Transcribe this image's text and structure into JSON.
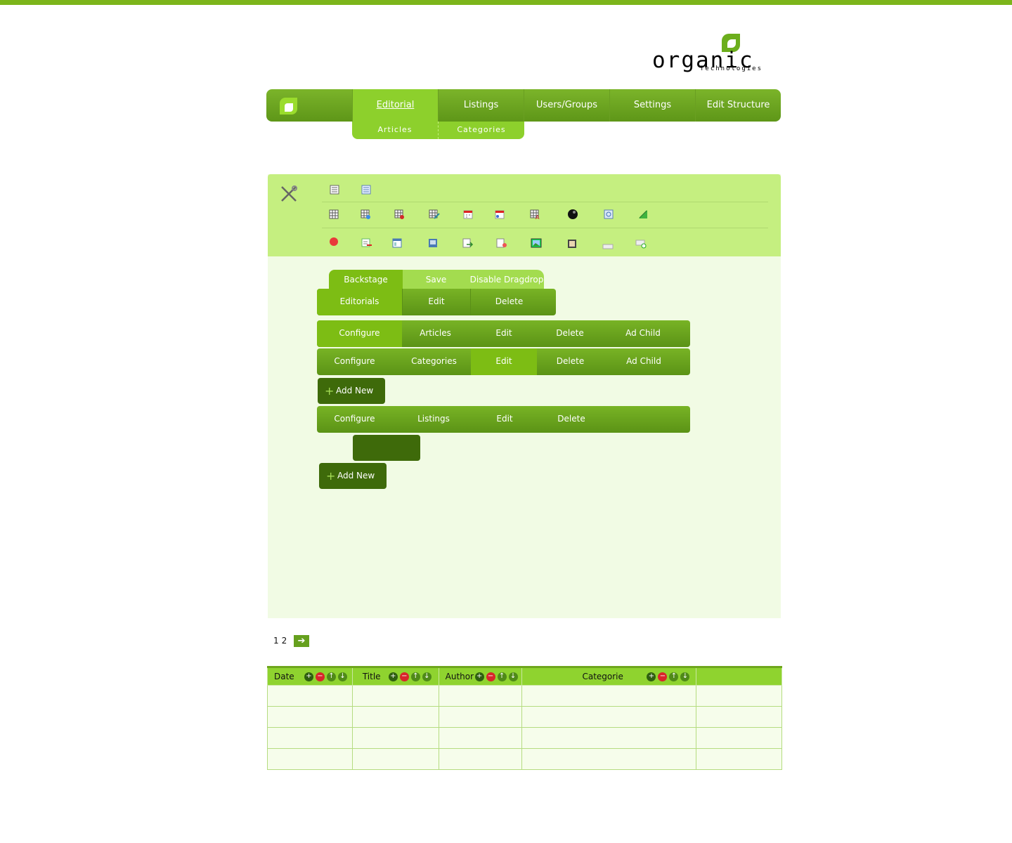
{
  "brand": {
    "logo_word": "organic",
    "logo_sub": "Technologies"
  },
  "nav": {
    "tabs": [
      "Editorial",
      "Listings",
      "Users/Groups",
      "Settings",
      "Edit Structure"
    ],
    "sub": [
      "Articles",
      "Categories"
    ]
  },
  "panel": {
    "tabs_top": [
      "Backstage",
      "Save",
      "Disable Dragdrop"
    ],
    "editorials_bar": [
      "Editorials",
      "Edit",
      "Delete"
    ],
    "articles_bar": [
      "Configure",
      "Articles",
      "Edit",
      "Delete",
      "Ad Child"
    ],
    "categories_bar": [
      "Configure",
      "Categories",
      "Edit",
      "Delete",
      "Ad Child"
    ],
    "listings_bar": [
      "Configure",
      "Listings",
      "Edit",
      "Delete"
    ],
    "add_new": "Add New"
  },
  "pager": {
    "pages": [
      "1",
      "2"
    ],
    "next": "➔"
  },
  "table": {
    "headers": [
      "Date",
      "Title",
      "Author",
      "Categorie",
      ""
    ]
  },
  "colors": {
    "accent": "#7cb51b",
    "dark": "#3e6a0a",
    "light": "#c5ef80"
  },
  "icons": [
    "tools-icon",
    "table-icon",
    "calendar-icon",
    "grid-icon",
    "image-icon",
    "edit-icon"
  ]
}
